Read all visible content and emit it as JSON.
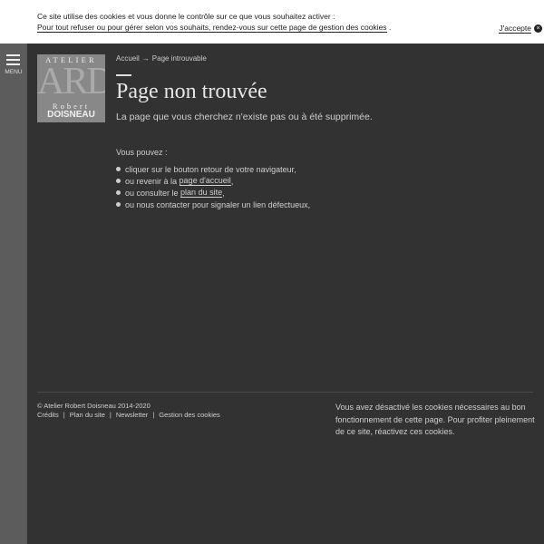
{
  "cookie_banner": {
    "line1": "Ce site utilise des cookies et vous donne le contrôle sur ce que vous souhaitez activer :",
    "line2": "Pour tout refuser ou pour gérer selon vos souhaits, rendez-vous sur cette page de gestion des cookies",
    "line2_end": ".",
    "accept_label": "J'accepte",
    "accept_icon": "×"
  },
  "sidebar": {
    "menu_label": "MENU"
  },
  "logo": {
    "line1": "ATELIER",
    "line2": "ARD",
    "line3": "Robert",
    "line4": "DOISNEAU"
  },
  "breadcrumb": {
    "home": "Accueil",
    "separator": "→",
    "current": "Page introuvable"
  },
  "main": {
    "title": "Page non trouvée",
    "subtitle": "La page que vous cherchez n'existe pas ou à été supprimée.",
    "intro": "Vous pouvez :",
    "options": [
      {
        "prefix": "cliquer sur le bouton retour de votre navigateur,",
        "link": "",
        "suffix": ""
      },
      {
        "prefix": "ou revenir à la ",
        "link": "page d'accueil",
        "suffix": ","
      },
      {
        "prefix": "ou consulter le ",
        "link": "plan du site",
        "suffix": ","
      },
      {
        "prefix": "ou nous contacter pour signaler un lien défectueux,",
        "link": "",
        "suffix": ""
      }
    ]
  },
  "footer": {
    "copyright": "© Atelier Robert Doisneau 2014-2020",
    "links": [
      "Crédits",
      "Plan du site",
      "Newsletter",
      "Gestion des cookies"
    ],
    "separator": "|",
    "cookie_note": "Vous avez désactivé les cookies nécessaires au bon fonctionnement de cette page. Pour profiter pleinement de ce site, réactivez ces cookies."
  }
}
